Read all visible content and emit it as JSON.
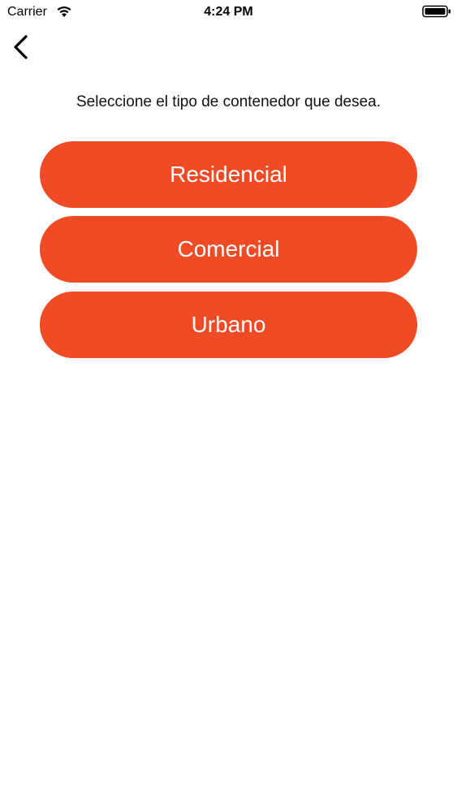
{
  "status_bar": {
    "carrier": "Carrier",
    "time": "4:24 PM",
    "wifi_icon": "wifi-icon",
    "battery_icon": "battery-icon"
  },
  "nav": {
    "back_icon": "chevron-left-icon"
  },
  "main": {
    "instruction": "Seleccione el tipo de contenedor que desea.",
    "options": [
      {
        "label": "Residencial"
      },
      {
        "label": "Comercial"
      },
      {
        "label": "Urbano"
      }
    ]
  },
  "colors": {
    "accent": "#f04b25",
    "button_text": "#ffffff",
    "background": "#ffffff"
  }
}
